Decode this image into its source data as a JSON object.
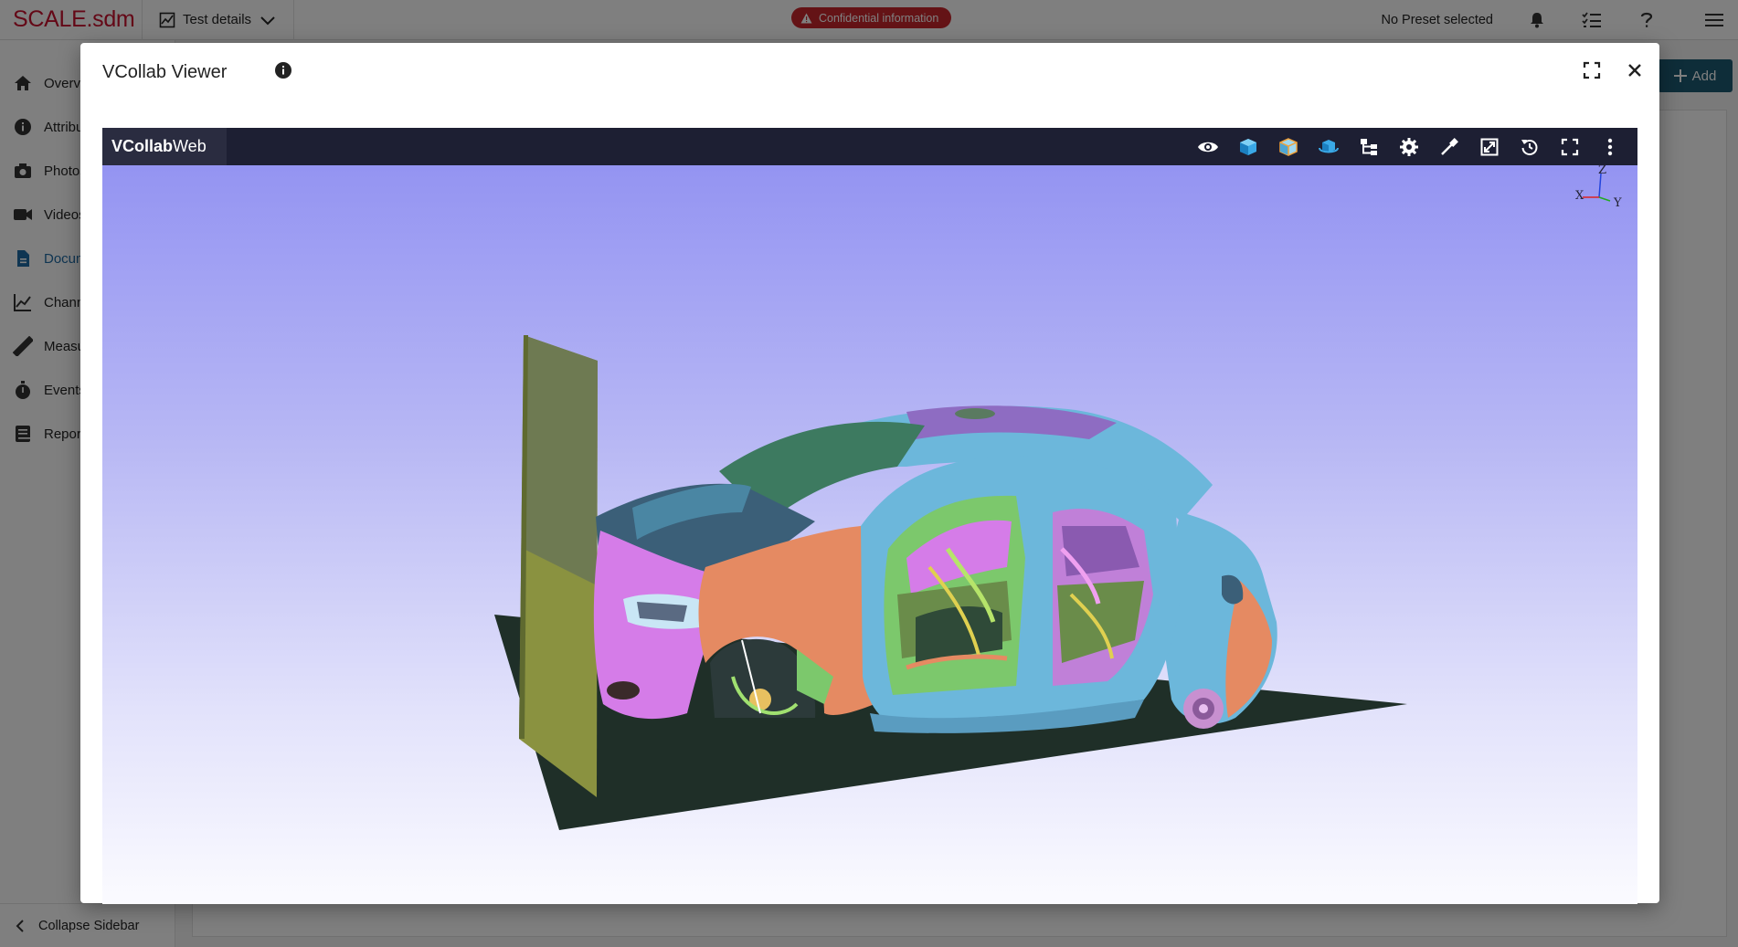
{
  "app": {
    "brand": "SCALE.sdm",
    "breadcrumb": "Test details",
    "confidential_badge": "Confidential information",
    "preset": "No Preset selected"
  },
  "sidebar": {
    "items": [
      {
        "label": "Overview",
        "icon": "home-icon"
      },
      {
        "label": "Attributes",
        "icon": "info-icon"
      },
      {
        "label": "Photos",
        "icon": "camera-icon"
      },
      {
        "label": "Videos",
        "icon": "video-icon"
      },
      {
        "label": "Documents",
        "icon": "document-icon",
        "active": true
      },
      {
        "label": "Channels",
        "icon": "chart-line-icon"
      },
      {
        "label": "Measurements",
        "icon": "ruler-icon"
      },
      {
        "label": "Events",
        "icon": "stopwatch-icon"
      },
      {
        "label": "Reports",
        "icon": "book-icon"
      }
    ],
    "collapse_label": "Collapse Sidebar"
  },
  "main": {
    "add_button_label": "Add"
  },
  "modal": {
    "title": "VCollab Viewer"
  },
  "viewer": {
    "logo_bold": "VCollab",
    "logo_light": " Web",
    "toolbar": [
      "eye-icon",
      "cube-solid-icon",
      "cube-outline-icon",
      "cube-rotate-icon",
      "tree-icon",
      "settings-icon",
      "probe-icon",
      "fit-icon",
      "reset-icon",
      "fullscreen-icon",
      "more-vert-icon"
    ],
    "axes": {
      "x": "X",
      "y": "Y",
      "z": "Z"
    }
  },
  "colors": {
    "brand_red": "#c8102e",
    "badge_red": "#c8262d",
    "accent_teal": "#1d5b73",
    "viewer_bar": "#1d1f33",
    "car_blue": "#6cb7db",
    "car_pink": "#d57ce8",
    "car_orange": "#e58a62",
    "floor": "#1f2f28",
    "barrier": "#8a9240"
  }
}
